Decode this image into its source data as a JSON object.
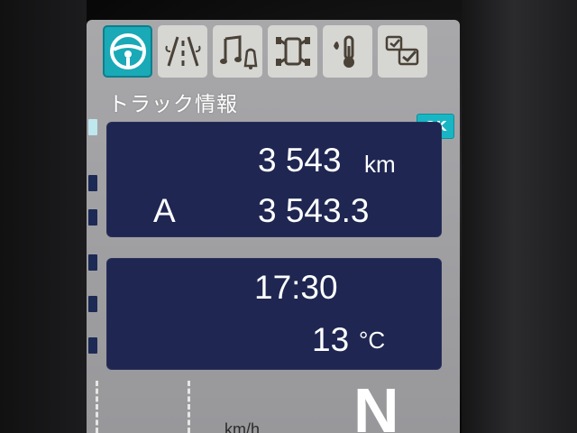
{
  "tabs": [
    {
      "icon": "steering-wheel-icon",
      "active": true
    },
    {
      "icon": "lane-assist-icon",
      "active": false
    },
    {
      "icon": "audio-music-icon",
      "active": false
    },
    {
      "icon": "vehicle-settings-icon",
      "active": false
    },
    {
      "icon": "temperature-icon",
      "active": false
    },
    {
      "icon": "checklist-icon",
      "active": false
    }
  ],
  "section_title": "トラック情報",
  "ok_label": "OK",
  "trip_panel": {
    "odometer": "3 543",
    "odometer_unit": "km",
    "trip_label": "A",
    "trip_value": "3 543.3"
  },
  "info_panel": {
    "clock": "17:30",
    "temperature": "13",
    "temperature_unit": "°C"
  },
  "speed_unit": "km/h",
  "gear": "N",
  "colors": {
    "screen_bg": "#a1a1a4",
    "panel_bg": "#1e2651",
    "accent": "#18b6c4",
    "tab_bg": "#d6d6d3"
  }
}
